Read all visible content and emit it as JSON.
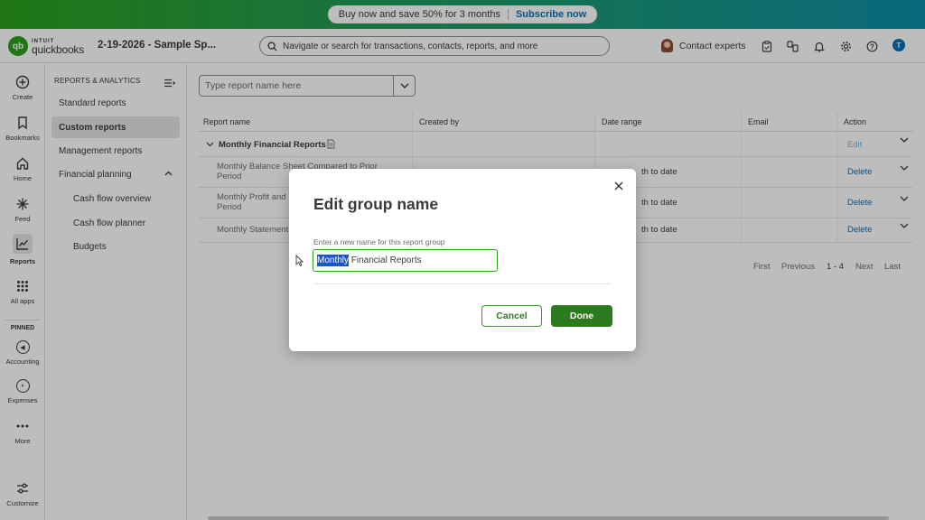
{
  "promo": {
    "text": "Buy now and save 50% for 3 months",
    "cta": "Subscribe now"
  },
  "header": {
    "logo_brand": "INTUIT",
    "logo_product": "quickbooks",
    "logo_mark": "qb",
    "company": "2-19-2026 - Sample Sp...",
    "search_placeholder": "Navigate or search for transactions, contacts, reports, and more",
    "contact_experts": "Contact experts",
    "user_initial": "T"
  },
  "rail": {
    "create": "Create",
    "bookmarks": "Bookmarks",
    "home": "Home",
    "feed": "Feed",
    "reports": "Reports",
    "all_apps": "All apps",
    "pinned": "PINNED",
    "accounting": "Accounting",
    "expenses": "Expenses",
    "more": "More",
    "customize": "Customize"
  },
  "subnav": {
    "title": "REPORTS & ANALYTICS",
    "items": [
      "Standard reports",
      "Custom reports",
      "Management reports",
      "Financial planning",
      "Cash flow overview",
      "Cash flow planner",
      "Budgets"
    ]
  },
  "main": {
    "typeahead_placeholder": "Type report name here",
    "columns": [
      "Report name",
      "Created by",
      "Date range",
      "Email",
      "Action"
    ],
    "group_name": "Monthly Financial Reports",
    "group_action": "Edit",
    "rows": [
      {
        "name_line1": "Monthly Balance Sheet Compared to Prior",
        "name_line2": "Period",
        "date_range": "th to date",
        "action": "Delete"
      },
      {
        "name_line1": "Monthly Profit and L",
        "name_line2": "Period",
        "date_range": "th to date",
        "action": "Delete"
      },
      {
        "name_line1": "Monthly Statement",
        "name_line2": "",
        "date_range": "th to date",
        "action": "Delete"
      }
    ],
    "pager": {
      "first": "First",
      "previous": "Previous",
      "range": "1 - 4",
      "next": "Next",
      "last": "Last"
    }
  },
  "modal": {
    "title": "Edit group name",
    "label": "Enter a new name for this report group",
    "value_selected": "Monthly",
    "value_rest": " Financial Reports",
    "cancel": "Cancel",
    "done": "Done"
  },
  "colors": {
    "brand_green": "#2ca01c",
    "dark_green": "#2b7a1e",
    "link_blue": "#0d6fb8",
    "selection_blue": "#1a56c9"
  }
}
